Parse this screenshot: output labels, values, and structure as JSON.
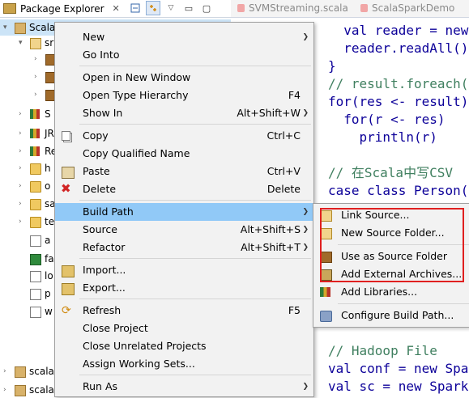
{
  "package_explorer": {
    "title": "Package Explorer",
    "close_glyph": "✕",
    "toolbar": {
      "collapse_icon": "collapse-all-icon",
      "link_icon": "link-with-editor-icon",
      "menu_glyph": "▽",
      "minimize_glyph": "▭",
      "maximize_glyph": "▢"
    },
    "tree": [
      {
        "label": "ScalaSparkDemo",
        "icon": "project-icon",
        "expanded": true,
        "selected": true
      },
      {
        "label": "sr",
        "icon": "source-folder-icon",
        "expanded": true
      },
      {
        "label": "",
        "icon": "package-icon"
      },
      {
        "label": "",
        "icon": "package-icon"
      },
      {
        "label": "",
        "icon": "package-icon"
      },
      {
        "label": "S",
        "icon": "library-icon"
      },
      {
        "label": "JR",
        "icon": "library-icon"
      },
      {
        "label": "Re",
        "icon": "library-icon"
      },
      {
        "label": "h",
        "icon": "folder-icon"
      },
      {
        "label": "o",
        "icon": "folder-icon"
      },
      {
        "label": "sa",
        "icon": "folder-icon"
      },
      {
        "label": "te",
        "icon": "folder-icon"
      },
      {
        "label": "a",
        "icon": "file-icon"
      },
      {
        "label": "fa",
        "icon": "excel-file-icon"
      },
      {
        "label": "lo",
        "icon": "file-icon"
      },
      {
        "label": "p",
        "icon": "file-icon"
      },
      {
        "label": "w",
        "icon": "file-icon"
      },
      {
        "label": "scala",
        "icon": "project-icon"
      },
      {
        "label": "scala",
        "icon": "project-icon"
      }
    ]
  },
  "editor": {
    "tabs": [
      {
        "label": "SVMStreaming.scala",
        "icon": "scala-file-icon"
      },
      {
        "label": "ScalaSparkDemo",
        "icon": "scala-file-icon"
      }
    ],
    "code_lines": [
      {
        "prefix": "  val reader = new",
        "kind": "code"
      },
      {
        "prefix": "  reader.readAll()",
        "kind": "code"
      },
      {
        "prefix": "}",
        "kind": "code"
      },
      {
        "prefix": "// result.foreach(",
        "kind": "comment"
      },
      {
        "prefix": "for(res <- result)",
        "kind": "code"
      },
      {
        "prefix": "  for(r <- res)",
        "kind": "code"
      },
      {
        "prefix": "    println(r)",
        "kind": "code"
      },
      {
        "prefix": "",
        "kind": "blank"
      },
      {
        "prefix": "// 在Scala中写CSV",
        "kind": "comment"
      },
      {
        "prefix": "case class Person(",
        "kind": "code"
      },
      {
        "prefix": "// Hadoop File",
        "kind": "comment"
      },
      {
        "prefix": "val conf = new Spark",
        "kind": "code"
      },
      {
        "prefix": "val sc = new SparkCo",
        "kind": "code"
      }
    ]
  },
  "context_menu": {
    "items": [
      {
        "label": "New",
        "submenu": true
      },
      {
        "label": "Go Into"
      },
      {
        "sep": true
      },
      {
        "label": "Open in New Window"
      },
      {
        "label": "Open Type Hierarchy",
        "shortcut": "F4"
      },
      {
        "label": "Show In",
        "shortcut": "Alt+Shift+W",
        "submenu": true
      },
      {
        "sep": true
      },
      {
        "label": "Copy",
        "shortcut": "Ctrl+C",
        "icon": "copy-icon"
      },
      {
        "label": "Copy Qualified Name"
      },
      {
        "label": "Paste",
        "shortcut": "Ctrl+V",
        "icon": "paste-icon"
      },
      {
        "label": "Delete",
        "shortcut": "Delete",
        "icon": "delete-icon"
      },
      {
        "sep": true
      },
      {
        "label": "Build Path",
        "submenu": true,
        "highlighted": true
      },
      {
        "label": "Source",
        "shortcut": "Alt+Shift+S",
        "submenu": true
      },
      {
        "label": "Refactor",
        "shortcut": "Alt+Shift+T",
        "submenu": true
      },
      {
        "sep": true
      },
      {
        "label": "Import...",
        "icon": "import-icon"
      },
      {
        "label": "Export...",
        "icon": "export-icon"
      },
      {
        "sep": true
      },
      {
        "label": "Refresh",
        "shortcut": "F5",
        "icon": "refresh-icon"
      },
      {
        "label": "Close Project"
      },
      {
        "label": "Close Unrelated Projects"
      },
      {
        "label": "Assign Working Sets..."
      },
      {
        "sep": true
      },
      {
        "label": "Run As",
        "submenu": true
      }
    ]
  },
  "build_path_submenu": {
    "items": [
      {
        "label": "Link Source...",
        "icon": "link-source-icon"
      },
      {
        "label": "New Source Folder...",
        "icon": "new-source-folder-icon"
      },
      {
        "sep": true
      },
      {
        "label": "Use as Source Folder",
        "icon": "use-as-source-folder-icon"
      },
      {
        "label": "Add External Archives...",
        "icon": "add-external-archives-icon"
      },
      {
        "label": "Add Libraries...",
        "icon": "add-libraries-icon"
      },
      {
        "sep": true
      },
      {
        "label": "Configure Build Path...",
        "icon": "configure-build-path-icon"
      }
    ]
  },
  "colors": {
    "menu_highlight": "#91c9f7",
    "annotation_box": "#e02020",
    "selection": "#cce4f7"
  }
}
